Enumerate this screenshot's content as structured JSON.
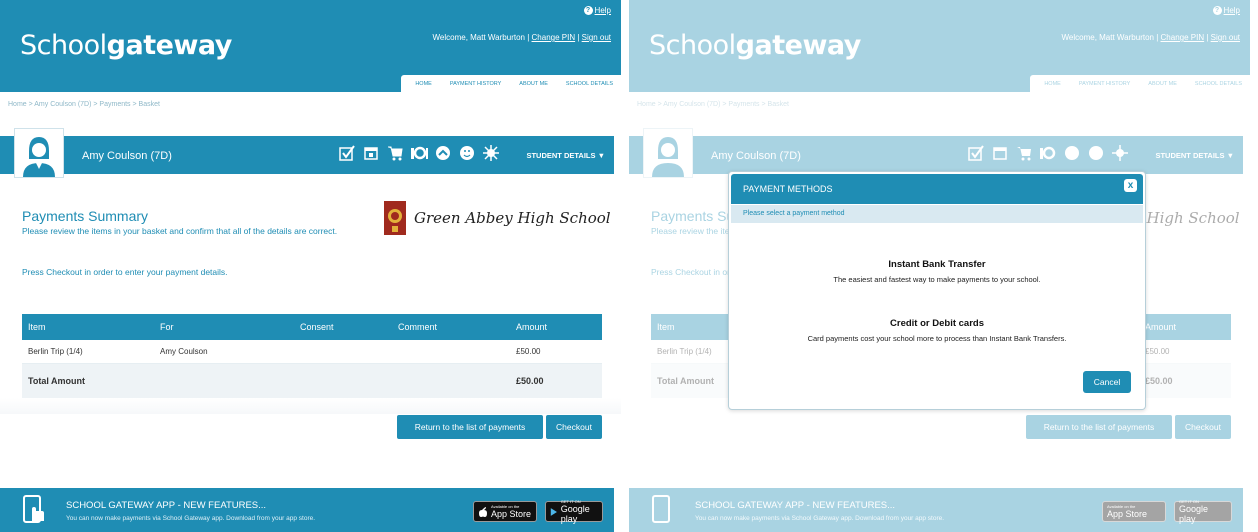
{
  "brand": {
    "logo_prefix": "Sch",
    "logo_oo": "oo",
    "logo_mid": "l",
    "logo_suffix": "gateway"
  },
  "header": {
    "help": "Help",
    "welcome_prefix": "Welcome, Matt Warburton |",
    "change_pin": "Change PIN",
    "sign_out": "Sign out",
    "nav": [
      "HOME",
      "PAYMENT HISTORY",
      "ABOUT ME",
      "SCHOOL DETAILS"
    ]
  },
  "breadcrumb": "Home > Amy Coulson (7D) > Payments > Basket",
  "student": {
    "name": "Amy Coulson (7D)",
    "details_label": "STUDENT DETAILS ▼"
  },
  "school": {
    "name": "Green Abbey High School"
  },
  "summary": {
    "title": "Payments Summary",
    "text": "Please review the items in your basket and confirm that all of the details are correct.",
    "text2": "Press Checkout in order to enter your payment details."
  },
  "table": {
    "columns": [
      "Item",
      "For",
      "Consent",
      "Comment",
      "Amount"
    ],
    "rows": [
      {
        "item": "Berlin Trip (1/4)",
        "for": "Amy Coulson",
        "consent": "",
        "comment": "",
        "amount": "£50.00"
      }
    ],
    "total_label": "Total Amount",
    "total_value": "£50.00"
  },
  "buttons": {
    "return": "Return to the list of payments",
    "checkout": "Checkout"
  },
  "footer": {
    "title": "SCHOOL GATEWAY APP - NEW FEATURES...",
    "subtitle": "You can now make payments via School Gateway app. Download from your app store.",
    "appstore_small": "Available on the",
    "appstore_big": "App Store",
    "google_small": "GET IT ON",
    "google_big": "Google play"
  },
  "modal": {
    "title": "PAYMENT METHODS",
    "close": "x",
    "subtitle": "Please select a payment method",
    "options": [
      {
        "title": "Instant Bank Transfer",
        "text": "The easiest and fastest way to make payments to your school."
      },
      {
        "title": "Credit or Debit cards",
        "text": "Card payments cost your school more to process than Instant Bank Transfers."
      }
    ],
    "cancel": "Cancel"
  },
  "colors": {
    "primary": "#1f8db4",
    "modal_sub_bg": "#d9e9f1"
  }
}
